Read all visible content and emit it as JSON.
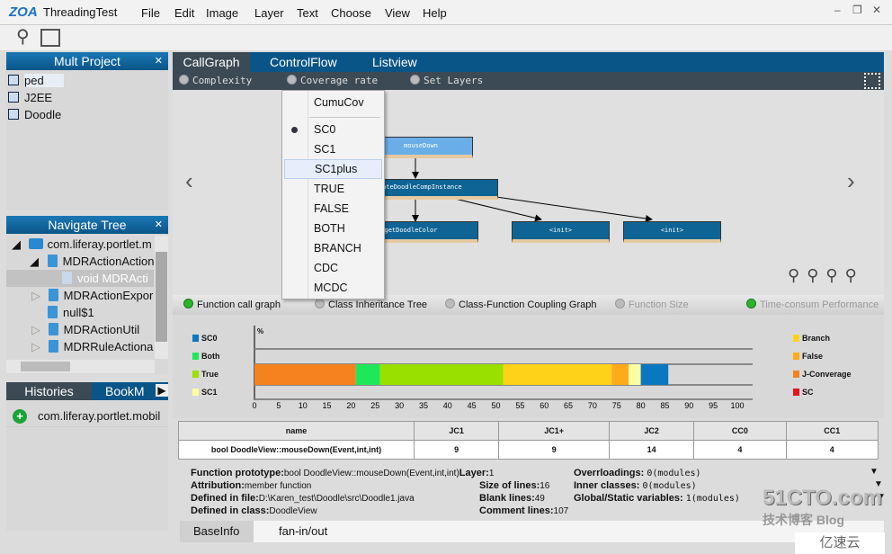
{
  "app": {
    "logo": "ZOA",
    "title": "ThreadingTest",
    "menu": [
      "File",
      "Edit",
      "Image",
      "Layer",
      "Text",
      "Choose",
      "View",
      "Help"
    ]
  },
  "toolbar": {
    "icons": [
      "search-icon",
      "export-icon"
    ]
  },
  "mult_project": {
    "title": "Mult Project",
    "items": [
      "ped",
      "J2EE",
      "Doodle"
    ]
  },
  "navigate_tree": {
    "title": "Navigate Tree",
    "items": [
      "com.liferay.portlet.m",
      "MDRActionAction",
      "void MDRActi",
      "MDRActionExpor",
      "null$1",
      "MDRActionUtil",
      "MDRRuleActionak"
    ]
  },
  "histories": {
    "tabs": [
      "Histories",
      "BookM"
    ],
    "items": [
      "com.liferay.portlet.mobil"
    ]
  },
  "main": {
    "tabs": [
      "CallGraph",
      "ControlFlow",
      "Listview"
    ],
    "options": [
      "Complexity",
      "Coverage rate",
      "Set Layers"
    ]
  },
  "coverage_menu": {
    "items": [
      "CumuCov",
      "SC0",
      "SC1",
      "SC1plus",
      "TRUE",
      "FALSE",
      "BOTH",
      "BRANCH",
      "CDC",
      "MCDC"
    ],
    "selected": "SC0",
    "hovered": "SC1plus"
  },
  "graph": {
    "nodes": [
      "mouseDown",
      "createDoodleCompInstance",
      "getDoodleColor",
      "<init>",
      "<init>"
    ]
  },
  "view_options": {
    "items": [
      "Function call graph",
      "Class Inheritance Tree",
      "Class-Function Coupling Graph",
      "Function Size",
      "Time-consum Performance"
    ]
  },
  "chart_data": {
    "type": "bar",
    "ylabel": "%",
    "xlim": [
      0,
      100
    ],
    "ticks": [
      0,
      5,
      10,
      15,
      20,
      25,
      30,
      35,
      40,
      45,
      50,
      55,
      60,
      65,
      70,
      75,
      80,
      85,
      90,
      95,
      100
    ],
    "segments": [
      {
        "name": "J-Converage",
        "start": 0,
        "end": 21,
        "color": "#f5821f"
      },
      {
        "name": "Both",
        "start": 21,
        "end": 26,
        "color": "#1ee85a"
      },
      {
        "name": "True",
        "start": 26,
        "end": 51.5,
        "color": "#99e000"
      },
      {
        "name": "Branch",
        "start": 51.5,
        "end": 74,
        "color": "#ffd21a"
      },
      {
        "name": "False",
        "start": 74,
        "end": 77.5,
        "color": "#ffaa1a"
      },
      {
        "name": "SC1",
        "start": 77.5,
        "end": 80,
        "color": "#ffffa0"
      },
      {
        "name": "SC0",
        "start": 80,
        "end": 85.7,
        "color": "#0a78c0"
      }
    ],
    "legend_left": [
      {
        "name": "SC0",
        "color": "#0a78c0"
      },
      {
        "name": "Both",
        "color": "#1ee85a"
      },
      {
        "name": "True",
        "color": "#99e000"
      },
      {
        "name": "SC1",
        "color": "#ffffa0"
      }
    ],
    "legend_right": [
      {
        "name": "Branch",
        "color": "#ffd21a"
      },
      {
        "name": "False",
        "color": "#ffaa1a"
      },
      {
        "name": "J-Converage",
        "color": "#f5821f"
      },
      {
        "name": "SC",
        "color": "#e8141e"
      }
    ]
  },
  "table": {
    "headers": [
      "name",
      "JC1",
      "JC1+",
      "JC2",
      "CC0",
      "CC1"
    ],
    "rows": [
      [
        "bool DoodleView::mouseDown(Event,int,int)",
        "9",
        "9",
        "14",
        "4",
        "4"
      ]
    ]
  },
  "info": {
    "prototype_label": "Function prototype:",
    "prototype": "bool DoodleView::mouseDown(Event,int,int)",
    "attribution_label": "Attribution:",
    "attribution": "member function",
    "file_label": "Defined in file:",
    "file": "D:\\Karen_test\\Doodle\\src\\Doodle1.java",
    "class_label": "Defined in class:",
    "class": "DoodleView",
    "layer_label": "Layer:",
    "layer": "1",
    "size_label": "Size of lines:",
    "size": "16",
    "blank_label": "Blank lines:",
    "blank": "49",
    "comment_label": "Comment lines:",
    "comment": "107",
    "overloadings_label": "Overrloadings:",
    "overloadings": "0(modules)",
    "inner_label": "Inner classes:",
    "inner": "0(modules)",
    "global_label": "Global/Static variables:",
    "global": "1(modules)"
  },
  "bottom_tabs": [
    "BaseInfo",
    "fan-in/out"
  ],
  "watermark": {
    "line1": "51CTO.com",
    "line2": "技术博客 Blog",
    "line3": "亿速云"
  }
}
